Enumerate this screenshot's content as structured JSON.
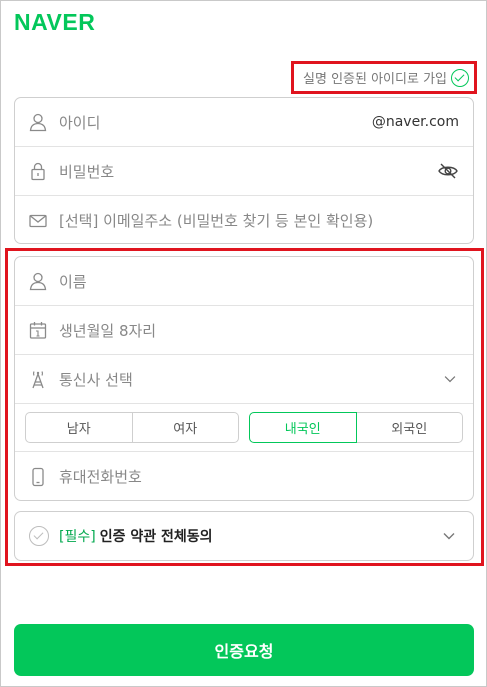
{
  "brand": {
    "logo_text": "NAVER",
    "accent": "#03c75a"
  },
  "real_name_link": {
    "label": "실명 인증된 아이디로 가입",
    "icon": "check-circle-icon"
  },
  "account": {
    "id": {
      "placeholder": "아이디",
      "suffix": "@naver.com",
      "icon": "user-icon"
    },
    "password": {
      "placeholder": "비밀번호",
      "icon": "lock-icon",
      "toggle_icon": "eye-slash-icon"
    },
    "email": {
      "placeholder": "[선택] 이메일주소 (비밀번호 찾기 등 본인 확인용)",
      "icon": "envelope-icon"
    }
  },
  "identity": {
    "name": {
      "placeholder": "이름",
      "icon": "user-icon"
    },
    "birth": {
      "placeholder": "생년월일 8자리",
      "icon": "calendar-icon"
    },
    "carrier": {
      "placeholder": "통신사 선택",
      "icon": "antenna-icon"
    },
    "gender": {
      "options": [
        "남자",
        "여자"
      ],
      "selected": null
    },
    "nationality": {
      "options": [
        "내국인",
        "외국인"
      ],
      "selected": "내국인"
    },
    "phone": {
      "placeholder": "휴대전화번호",
      "icon": "phone-icon"
    }
  },
  "agreement": {
    "required_tag": "[필수]",
    "label": "인증 약관 전체동의"
  },
  "submit": {
    "label": "인증요청"
  }
}
